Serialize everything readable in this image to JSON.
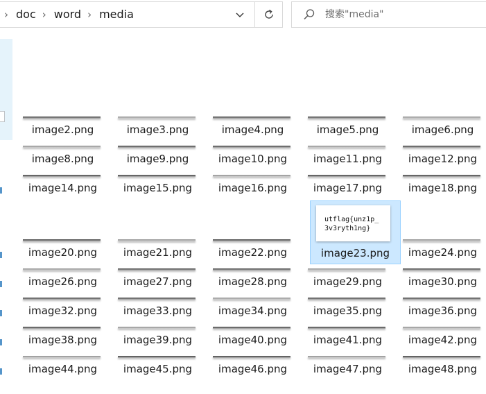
{
  "address_bar": {
    "crumbs": [
      "doc",
      "word",
      "media"
    ]
  },
  "search": {
    "placeholder": "搜索\"media\""
  },
  "icons": {
    "separator": "chevron-right-icon",
    "dropdown": "chevron-down-icon",
    "refresh": "refresh-icon",
    "search": "search-icon"
  },
  "colors": {
    "selection_fill": "#cce8ff",
    "selection_border": "#99d1ff",
    "border": "#d9d9d9"
  },
  "files": {
    "rows": [
      [
        "image2.png",
        "image3.png",
        "image4.png",
        "image5.png",
        "image6.png"
      ],
      [
        "image8.png",
        "image9.png",
        "image10.png",
        "image11.png",
        "image12.png"
      ],
      [
        "image14.png",
        "image15.png",
        "image16.png",
        "image17.png",
        "image18.png"
      ],
      [
        "image20.png",
        "image21.png",
        "image22.png",
        "image23.png",
        "image24.png"
      ],
      [
        "image26.png",
        "image27.png",
        "image28.png",
        "image29.png",
        "image30.png"
      ],
      [
        "image32.png",
        "image33.png",
        "image34.png",
        "image35.png",
        "image36.png"
      ],
      [
        "image38.png",
        "image39.png",
        "image40.png",
        "image41.png",
        "image42.png"
      ],
      [
        "image44.png",
        "image45.png",
        "image46.png",
        "image47.png",
        "image48.png"
      ]
    ],
    "selected": "image23.png",
    "selected_preview_text": [
      "utflag{unz1p_",
      "3v3ryth1ng}"
    ]
  }
}
